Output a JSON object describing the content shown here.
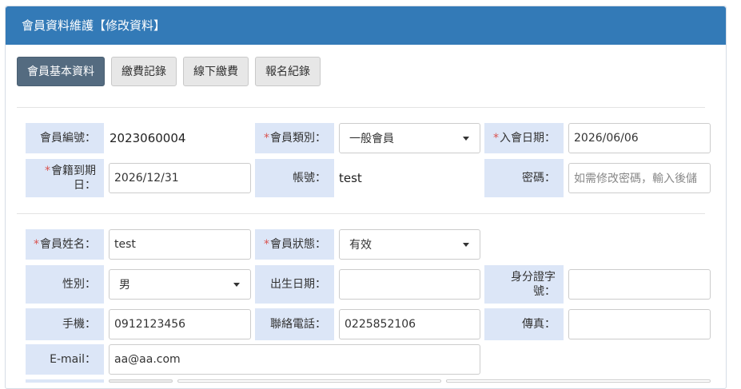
{
  "header": {
    "title": "會員資料維護【修改資料】"
  },
  "tabs": [
    {
      "label": "會員基本資料",
      "active": true
    },
    {
      "label": "繳費記錄"
    },
    {
      "label": "線下繳費"
    },
    {
      "label": "報名紀錄"
    }
  ],
  "colors": {
    "header_bg": "#337ab7",
    "active_tab": "#546b80",
    "label_bg": "#dce6f7",
    "required": "#d9534f"
  },
  "form": {
    "member_no": {
      "label": "會員編號：",
      "value": "2023060004"
    },
    "member_type": {
      "label": "會員類別：",
      "value": "一般會員"
    },
    "join_date": {
      "label": "入會日期：",
      "value": "2026/06/06"
    },
    "expiry_date": {
      "label_line1": "會籍到期",
      "label_line2": "日：",
      "value": "2026/12/31"
    },
    "account": {
      "label": "帳號：",
      "value": "test"
    },
    "password": {
      "label": "密碼：",
      "placeholder": "如需修改密碼，輸入後儲"
    },
    "name": {
      "label": "會員姓名：",
      "value": "test"
    },
    "status": {
      "label": "會員狀態：",
      "value": "有效"
    },
    "gender": {
      "label": "性別：",
      "value": "男"
    },
    "birth_date": {
      "label": "出生日期：",
      "value": ""
    },
    "id_no": {
      "label_line1": "身分證字",
      "label_line2": "號：",
      "value": ""
    },
    "mobile": {
      "label": "手機：",
      "value": "0912123456"
    },
    "phone": {
      "label": "聯絡電話：",
      "value": "0225852106"
    },
    "fax": {
      "label": "傳真：",
      "value": ""
    },
    "email": {
      "label": "E-mail：",
      "value": "aa@aa.com"
    }
  }
}
